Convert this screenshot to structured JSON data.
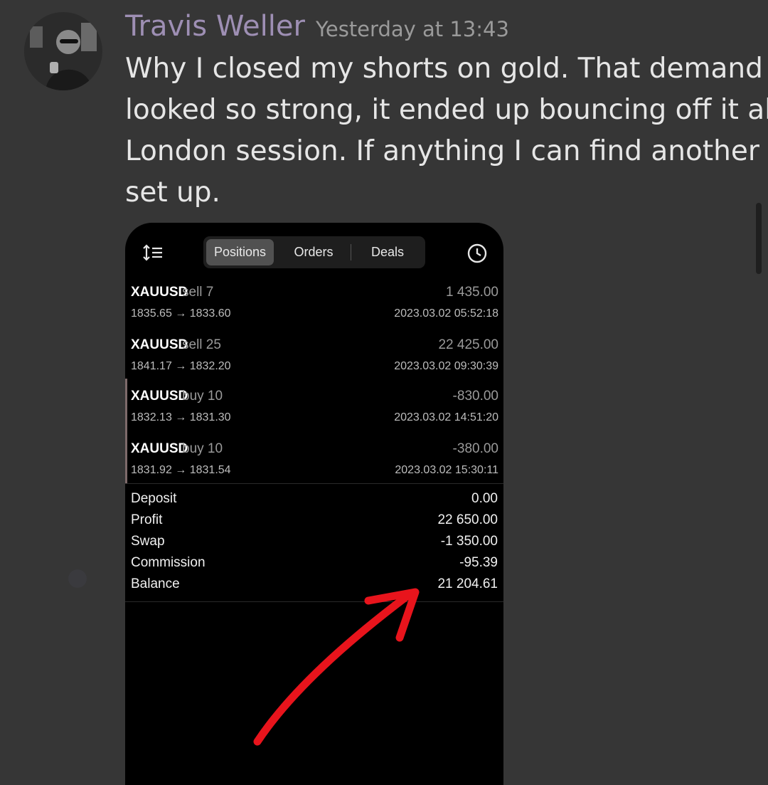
{
  "post": {
    "author": "Travis Weller",
    "timestamp": "Yesterday at 13:43",
    "lines": [
      "Why I closed my shorts on gold. That demand",
      "looked so strong, it ended up bouncing off it all",
      "London session. If anything I can find another",
      "set up."
    ]
  },
  "screenshot": {
    "tabs": [
      {
        "label": "Positions",
        "active": true
      },
      {
        "label": "Orders",
        "active": false
      },
      {
        "label": "Deals",
        "active": false
      }
    ],
    "icons": {
      "left": "sort-list-icon",
      "right": "history-clock-icon"
    },
    "positions": [
      {
        "symbol": "XAUUSD",
        "side": "sell 7",
        "profit": "1 435.00",
        "prices": "1835.65 → 1833.60",
        "time": "2023.03.02 05:52:18"
      },
      {
        "symbol": "XAUUSD",
        "side": "sell 25",
        "profit": "22 425.00",
        "prices": "1841.17 → 1832.20",
        "time": "2023.03.02 09:30:39"
      },
      {
        "symbol": "XAUUSD",
        "side": "buy 10",
        "profit": "-830.00",
        "prices": "1832.13 → 1831.30",
        "time": "2023.03.02 14:51:20"
      },
      {
        "symbol": "XAUUSD",
        "side": "buy 10",
        "profit": "-380.00",
        "prices": "1831.92 → 1831.54",
        "time": "2023.03.02 15:30:11"
      }
    ],
    "summary": [
      {
        "label": "Deposit",
        "value": "0.00"
      },
      {
        "label": "Profit",
        "value": "22 650.00"
      },
      {
        "label": "Swap",
        "value": "-1 350.00"
      },
      {
        "label": "Commission",
        "value": "-95.39"
      },
      {
        "label": "Balance",
        "value": "21 204.61"
      }
    ]
  },
  "colors": {
    "background": "#363636",
    "author": "#9e8fb4",
    "annotation_arrow": "#e8141c"
  }
}
